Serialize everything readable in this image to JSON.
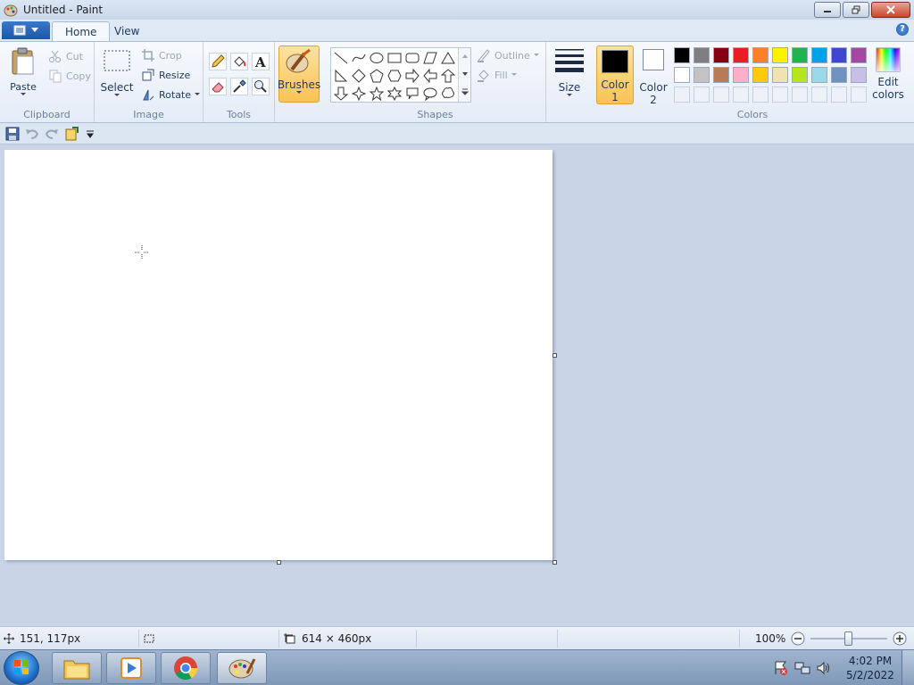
{
  "window": {
    "title": "Untitled - Paint"
  },
  "tabs": [
    {
      "label": "Home"
    },
    {
      "label": "View"
    }
  ],
  "ribbon": {
    "clipboard": {
      "label": "Clipboard",
      "paste": "Paste",
      "cut": "Cut",
      "copy": "Copy"
    },
    "image": {
      "label": "Image",
      "select": "Select",
      "crop": "Crop",
      "resize": "Resize",
      "rotate": "Rotate"
    },
    "tools": {
      "label": "Tools"
    },
    "brushes": {
      "label": "Brushes"
    },
    "shapes": {
      "label": "Shapes",
      "outline": "Outline",
      "fill": "Fill"
    },
    "size": {
      "label": "Size"
    },
    "colors": {
      "label": "Colors",
      "color1_line1": "Color",
      "color1_line2": "1",
      "color2_line1": "Color",
      "color2_line2": "2",
      "edit_line1": "Edit",
      "edit_line2": "colors",
      "color1": "#000000",
      "color2": "#ffffff",
      "palette_row1": [
        "#000000",
        "#7f7f7f",
        "#880015",
        "#ed1c24",
        "#ff7f27",
        "#fff200",
        "#22b14c",
        "#00a2e8",
        "#3f48cc",
        "#a349a4"
      ],
      "palette_row2": [
        "#ffffff",
        "#c3c3c3",
        "#b97a57",
        "#ffaec9",
        "#ffc90e",
        "#efe4b0",
        "#b5e61d",
        "#99d9ea",
        "#7092be",
        "#c8bfe7"
      ]
    }
  },
  "statusbar": {
    "cursor_position": "151, 117px",
    "canvas_size": "614 × 460px",
    "zoom": "100%"
  },
  "taskbar": {
    "time": "4:02 PM",
    "date": "5/2/2022"
  }
}
